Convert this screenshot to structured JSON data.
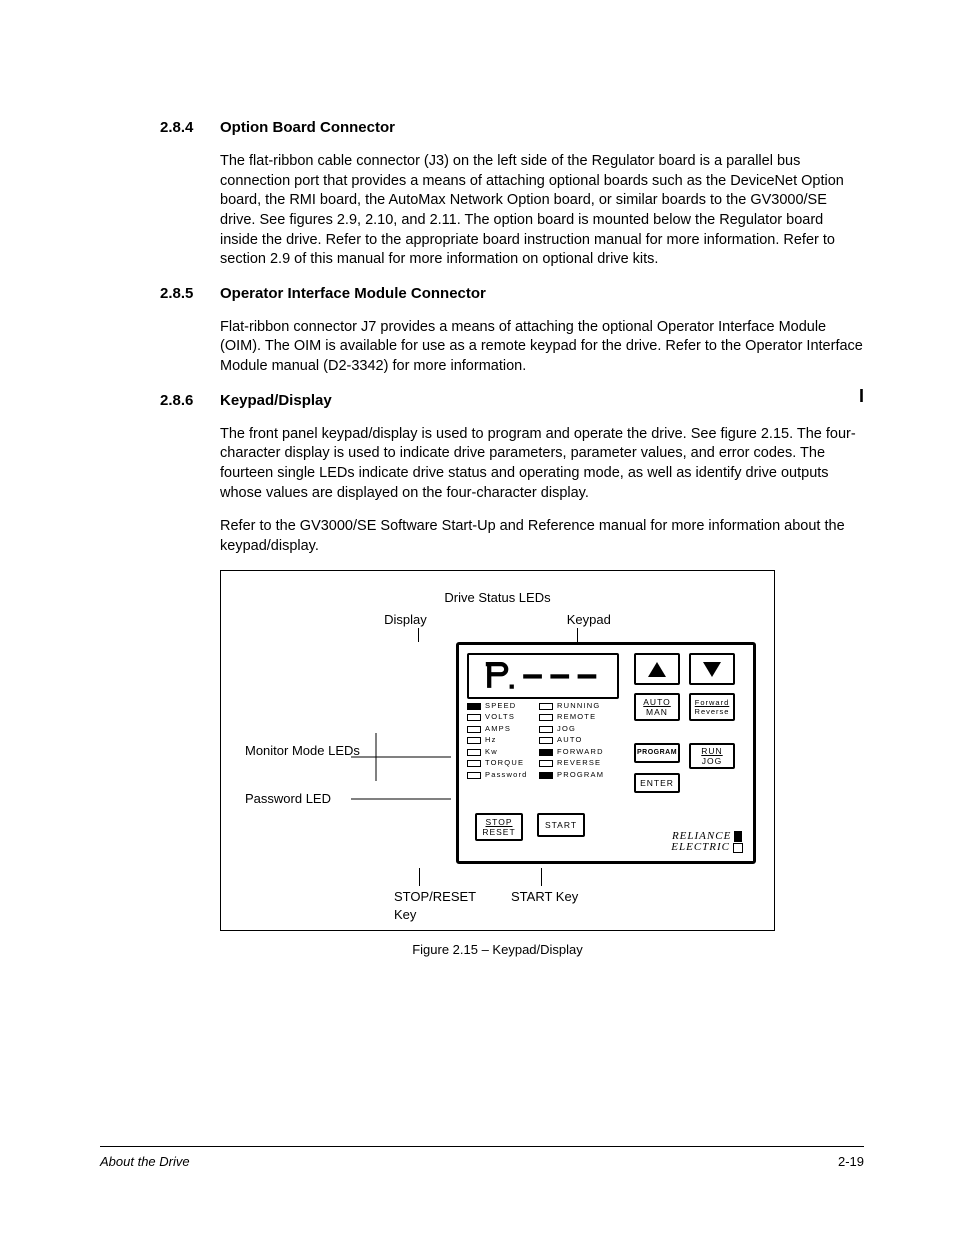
{
  "sections": [
    {
      "num": "2.8.4",
      "title": "Option Board Connector",
      "paras": [
        "The flat-ribbon cable connector (J3) on the left side of the Regulator board is a parallel bus connection port that provides a means of attaching optional boards such as the DeviceNet Option board, the RMI board, the AutoMax Network Option board, or similar boards to the GV3000/SE drive. See figures 2.9, 2.10, and 2.11. The option board is mounted below the Regulator board inside the drive. Refer to the appropriate board instruction manual for more information. Refer to section 2.9 of this manual for more information on optional drive kits."
      ]
    },
    {
      "num": "2.8.5",
      "title": "Operator Interface Module Connector",
      "paras": [
        "Flat-ribbon connector J7 provides a means of attaching the optional Operator Interface Module (OIM). The OIM is available for use as a remote keypad for the drive. Refer to the Operator Interface Module manual (D2-3342) for more information."
      ]
    },
    {
      "num": "2.8.6",
      "title": "Keypad/Display",
      "paras": [
        "The front panel keypad/display is used to program and operate the drive. See figure 2.15. The four-character display is used to indicate drive parameters, parameter values, and error codes. The fourteen single LEDs indicate drive status and operating mode, as well as identify drive outputs whose values are displayed on the four-character display.",
        "Refer to the GV3000/SE Software Start-Up and Reference manual for more information about the keypad/display."
      ]
    }
  ],
  "figure": {
    "caption": "Figure 2.15 – Keypad/Display",
    "top_center": "Drive Status LEDs",
    "top_left": "Display",
    "top_right": "Keypad",
    "side": {
      "monitor": "Monitor Mode LEDs",
      "password": "Password LED"
    },
    "bottom": {
      "stop": "STOP/RESET Key",
      "start": "START Key"
    },
    "display_value": "P.- - -",
    "leds_col1": [
      {
        "on": true,
        "t": "SPEED"
      },
      {
        "on": false,
        "t": "VOLTS"
      },
      {
        "on": false,
        "t": "AMPS"
      },
      {
        "on": false,
        "t": "Hz"
      },
      {
        "on": false,
        "t": "Kw"
      },
      {
        "on": false,
        "t": "TORQUE"
      },
      {
        "on": false,
        "t": "Password"
      }
    ],
    "leds_col2": [
      {
        "on": false,
        "t": "RUNNING"
      },
      {
        "on": false,
        "t": "REMOTE"
      },
      {
        "on": false,
        "t": "JOG"
      },
      {
        "on": false,
        "t": "AUTO"
      },
      {
        "on": true,
        "t": "FORWARD"
      },
      {
        "on": false,
        "t": "REVERSE"
      },
      {
        "on": true,
        "t": "PROGRAM"
      }
    ],
    "keys": {
      "auto1": "AUTO",
      "auto2": "MAN",
      "fwd1": "Forward",
      "fwd2": "Reverse",
      "prog": "PROGRAM",
      "run1": "RUN",
      "run2": "JOG",
      "enter": "ENTER",
      "stop1": "STOP",
      "stop2": "RESET",
      "start": "START"
    },
    "brand1": "RELIANCE",
    "brand2": "ELECTRIC"
  },
  "footer": {
    "left": "About the Drive",
    "right": "2-19"
  }
}
